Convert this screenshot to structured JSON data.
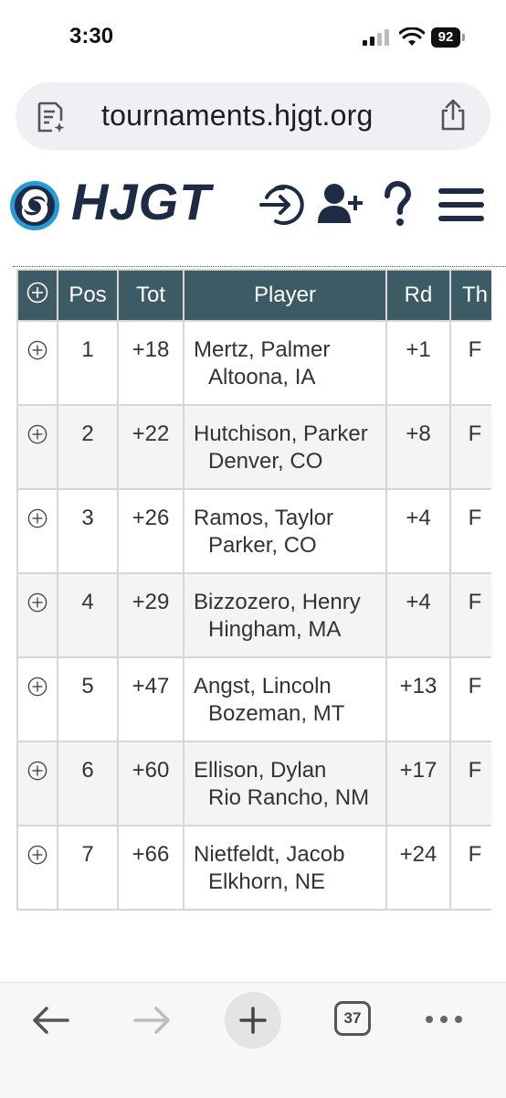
{
  "status": {
    "time": "3:30",
    "battery": "92"
  },
  "browser": {
    "url": "tournaments.hjgt.org",
    "tab_count": "37"
  },
  "site": {
    "logo_text": "HJGT"
  },
  "table": {
    "headers": {
      "expand": "",
      "pos": "Pos",
      "tot": "Tot",
      "player": "Player",
      "rd": "Rd",
      "th": "Th"
    },
    "rows": [
      {
        "pos": "1",
        "tot": "+18",
        "name": "Mertz, Palmer",
        "location": "Altoona, IA",
        "rd": "+1",
        "th": "F"
      },
      {
        "pos": "2",
        "tot": "+22",
        "name": "Hutchison, Parker",
        "location": "Denver, CO",
        "rd": "+8",
        "th": "F"
      },
      {
        "pos": "3",
        "tot": "+26",
        "name": "Ramos, Taylor",
        "location": "Parker, CO",
        "rd": "+4",
        "th": "F"
      },
      {
        "pos": "4",
        "tot": "+29",
        "name": "Bizzozero, Henry",
        "location": "Hingham, MA",
        "rd": "+4",
        "th": "F"
      },
      {
        "pos": "5",
        "tot": "+47",
        "name": "Angst, Lincoln",
        "location": "Bozeman, MT",
        "rd": "+13",
        "th": "F"
      },
      {
        "pos": "6",
        "tot": "+60",
        "name": "Ellison, Dylan",
        "location": "Rio Rancho, NM",
        "rd": "+17",
        "th": "F"
      },
      {
        "pos": "7",
        "tot": "+66",
        "name": "Nietfeldt, Jacob",
        "location": "Elkhorn, NE",
        "rd": "+24",
        "th": "F"
      }
    ]
  },
  "colors": {
    "header_bg": "#3c5b64",
    "brand_navy": "#1e2b45",
    "brand_blue": "#2a9ad6"
  },
  "icons": [
    "page-info-icon",
    "share-icon",
    "login-icon",
    "add-user-icon",
    "help-icon",
    "menu-icon",
    "back-icon",
    "forward-icon",
    "new-tab-icon",
    "tabs-icon",
    "more-icon",
    "expand-icon"
  ]
}
